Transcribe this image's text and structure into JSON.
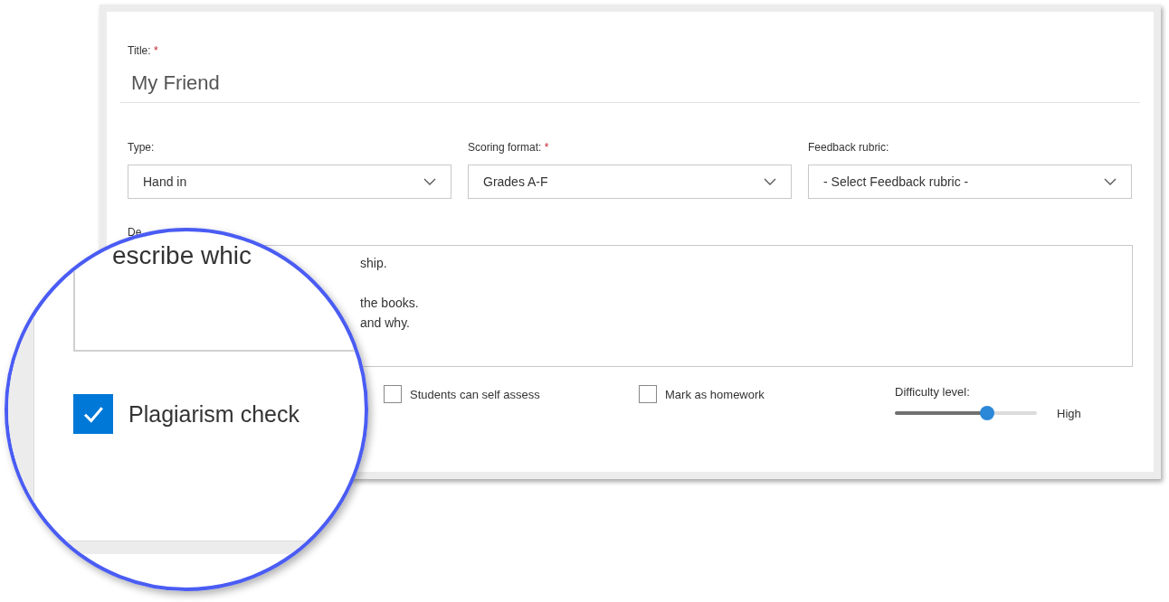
{
  "title_field": {
    "label": "Title:",
    "required_mark": "*",
    "value": "My Friend"
  },
  "selects": [
    {
      "label": "Type:",
      "value": "Hand in"
    },
    {
      "label": "Scoring format:",
      "required_mark": "*",
      "value": "Grades A-F"
    },
    {
      "label": "Feedback rubric:",
      "value": "- Select Feedback rubric -"
    }
  ],
  "description": {
    "label": "De",
    "lines": [
      "ship.",
      "the books.",
      "and why."
    ]
  },
  "options": [
    {
      "label": "Students can self assess",
      "checked": false
    },
    {
      "label": "Mark as homework",
      "checked": false
    }
  ],
  "difficulty": {
    "label": "Difficulty level:",
    "level": 0.65,
    "reading": "High"
  },
  "magnifier": {
    "excerpt": "escribe whic",
    "option": {
      "label": "Plagiarism check",
      "checked": true
    }
  }
}
